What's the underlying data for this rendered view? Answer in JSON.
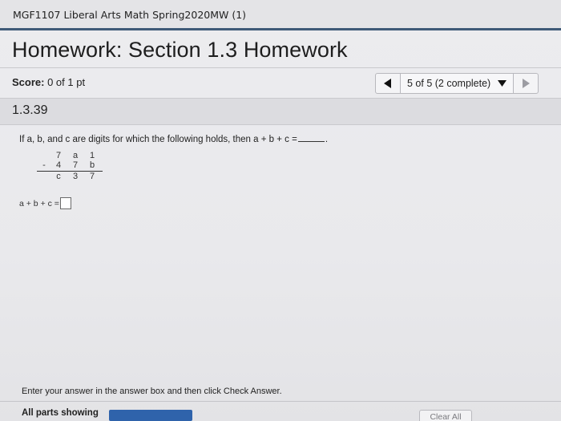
{
  "course": {
    "title": "MGF1107 Liberal Arts Math Spring2020MW (1)"
  },
  "homework": {
    "title": "Homework: Section 1.3 Homework"
  },
  "score": {
    "label": "Score:",
    "value": "0 of 1 pt"
  },
  "navigation": {
    "question_selector": "5 of 5 (2 complete)",
    "prev_icon": "triangle-left-icon",
    "next_icon": "triangle-right-icon"
  },
  "question": {
    "id": "1.3.39",
    "prompt_prefix": "If a, b, and c are digits for which the following holds, then a + b + c =",
    "prompt_suffix": ".",
    "arithmetic": {
      "row1": [
        "7",
        "a",
        "1"
      ],
      "operator": "-",
      "row2": [
        "4",
        "7",
        "b"
      ],
      "row3": [
        "c",
        "3",
        "7"
      ]
    },
    "answer_label": "a + b + c ="
  },
  "instructions": "Enter your answer in the answer box and then click Check Answer.",
  "footer": {
    "parts_label": "All parts showing",
    "clear_all": "Clear All"
  },
  "colors": {
    "accent": "#3f5a78",
    "progress": "#2f63ab"
  }
}
